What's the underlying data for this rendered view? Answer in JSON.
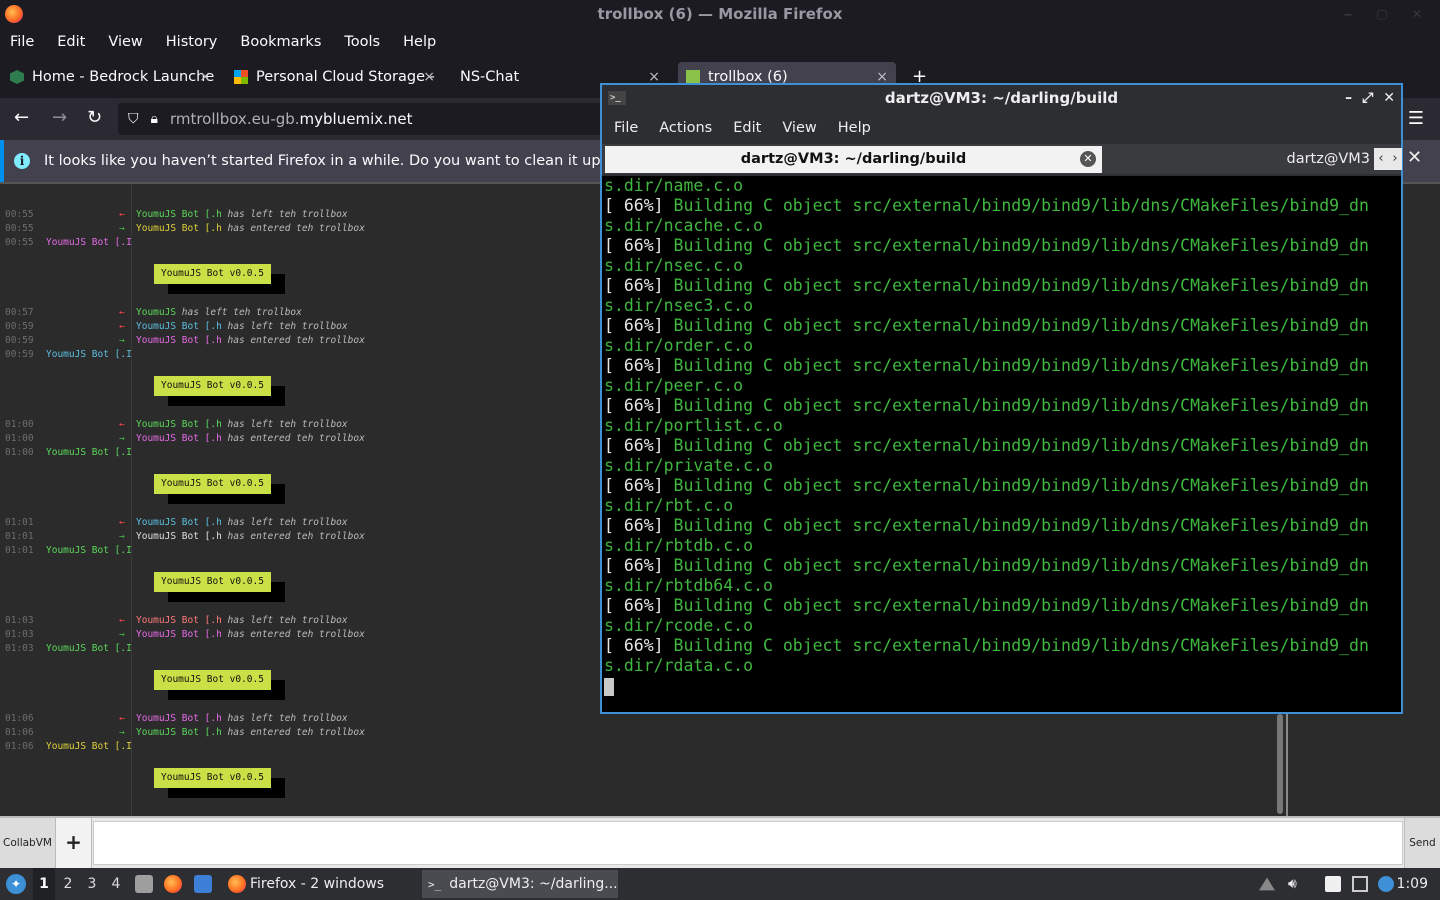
{
  "firefox": {
    "window_title": "trollbox (6) — Mozilla Firefox",
    "menu": [
      "File",
      "Edit",
      "View",
      "History",
      "Bookmarks",
      "Tools",
      "Help"
    ],
    "tabs": [
      {
        "label": "Home - Bedrock Launche",
        "close": "×"
      },
      {
        "label": "Personal Cloud Storage -",
        "close": "×"
      },
      {
        "label": "NS-Chat",
        "close": "×"
      },
      {
        "label": "trollbox (6)",
        "close": "×"
      }
    ],
    "new_tab": "+",
    "url_prefix": "rmtrollbox.eu-gb.",
    "url_domain": "mybluemix.net",
    "notification": "It looks like you haven’t started Firefox in a while. Do you want to clean it up for a f",
    "colors": {
      "accent": "#0090ed",
      "chrome": "#1c1b22"
    }
  },
  "trollbox": {
    "blocks": [
      {
        "lines": [
          {
            "time": "00:55",
            "dir": "out",
            "user": "YoumuJS Bot",
            "suffix": " [.h",
            "action": " has left teh trollbox",
            "color": "#5bd85b"
          },
          {
            "time": "00:55",
            "dir": "in",
            "user": "YoumuJS Bot",
            "suffix": " [.h",
            "action": " has entered teh trollbox",
            "color": "#e0d23a"
          }
        ],
        "speaker_time": "00:55",
        "speaker": "YoumuJS Bot [.I",
        "speaker_color": "#e86be8",
        "box": "YoumuJS Bot v0.0.5"
      },
      {
        "lines": [
          {
            "time": "00:57",
            "dir": "out",
            "user": "YoumuJS",
            "suffix": "",
            "action": " has left teh trollbox",
            "color": "#5bd85b"
          },
          {
            "time": "00:59",
            "dir": "out",
            "user": "YoumuJS Bot",
            "suffix": " [.h",
            "action": " has left teh trollbox",
            "color": "#5bc0e0"
          },
          {
            "time": "00:59",
            "dir": "in",
            "user": "YoumuJS Bot",
            "suffix": " [.h",
            "action": " has entered teh trollbox",
            "color": "#e86be8"
          }
        ],
        "speaker_time": "00:59",
        "speaker": "YoumuJS Bot [.I",
        "speaker_color": "#5bc0e0",
        "box": "YoumuJS Bot v0.0.5"
      },
      {
        "lines": [
          {
            "time": "01:00",
            "dir": "out",
            "user": "YoumuJS Bot",
            "suffix": " [.h",
            "action": " has left teh trollbox",
            "color": "#5bd85b"
          },
          {
            "time": "01:00",
            "dir": "in",
            "user": "YoumuJS Bot",
            "suffix": " [.h",
            "action": " has entered teh trollbox",
            "color": "#e86be8"
          }
        ],
        "speaker_time": "01:00",
        "speaker": "YoumuJS Bot [.I",
        "speaker_color": "#5bd85b",
        "box": "YoumuJS Bot v0.0.5"
      },
      {
        "lines": [
          {
            "time": "01:01",
            "dir": "out",
            "user": "YoumuJS Bot",
            "suffix": " [.h",
            "action": " has left teh trollbox",
            "color": "#5bc0e0"
          },
          {
            "time": "01:01",
            "dir": "in",
            "user": "YoumuJS Bot",
            "suffix": " [.h",
            "action": " has entered teh trollbox",
            "color": "#e0e0e0"
          }
        ],
        "speaker_time": "01:01",
        "speaker": "YoumuJS Bot [.I",
        "speaker_color": "#5bd85b",
        "box": "YoumuJS Bot v0.0.5"
      },
      {
        "lines": [
          {
            "time": "01:03",
            "dir": "out",
            "user": "YoumuJS Bot",
            "suffix": " [.h",
            "action": " has left teh trollbox",
            "color": "#ff7a7a"
          },
          {
            "time": "01:03",
            "dir": "in",
            "user": "YoumuJS Bot",
            "suffix": " [.h",
            "action": " has entered teh trollbox",
            "color": "#e86be8"
          }
        ],
        "speaker_time": "01:03",
        "speaker": "YoumuJS Bot [.I",
        "speaker_color": "#5bd85b",
        "box": "YoumuJS Bot v0.0.5"
      },
      {
        "lines": [
          {
            "time": "01:06",
            "dir": "out",
            "user": "YoumuJS Bot",
            "suffix": " [.h",
            "action": " has left teh trollbox",
            "color": "#e86be8"
          },
          {
            "time": "01:06",
            "dir": "in",
            "user": "YoumuJS Bot",
            "suffix": " [.h",
            "action": " has entered teh trollbox",
            "color": "#5bd85b"
          }
        ],
        "speaker_time": "01:06",
        "speaker": "YoumuJS Bot [.I",
        "speaker_color": "#e0d23a",
        "box": "YoumuJS Bot v0.0.5"
      }
    ],
    "arrows": {
      "in": "→",
      "out": "←"
    }
  },
  "chatbar": {
    "collab_label": "CollabVM",
    "add": "+",
    "send": "Send"
  },
  "terminal": {
    "title": "dartz@VM3: ~/darling/build",
    "menu": [
      "File",
      "Actions",
      "Edit",
      "View",
      "Help"
    ],
    "tab_active": "dartz@VM3: ~/darling/build",
    "tab_second": "dartz@VM3",
    "output": [
      {
        "pct": "",
        "text": "s.dir/name.c.o"
      },
      {
        "pct": "[ 66%]",
        "text": " Building C object src/external/bind9/bind9/lib/dns/CMakeFiles/bind9_dn"
      },
      {
        "pct": "",
        "text": "s.dir/ncache.c.o"
      },
      {
        "pct": "[ 66%]",
        "text": " Building C object src/external/bind9/bind9/lib/dns/CMakeFiles/bind9_dn"
      },
      {
        "pct": "",
        "text": "s.dir/nsec.c.o"
      },
      {
        "pct": "[ 66%]",
        "text": " Building C object src/external/bind9/bind9/lib/dns/CMakeFiles/bind9_dn"
      },
      {
        "pct": "",
        "text": "s.dir/nsec3.c.o"
      },
      {
        "pct": "[ 66%]",
        "text": " Building C object src/external/bind9/bind9/lib/dns/CMakeFiles/bind9_dn"
      },
      {
        "pct": "",
        "text": "s.dir/order.c.o"
      },
      {
        "pct": "[ 66%]",
        "text": " Building C object src/external/bind9/bind9/lib/dns/CMakeFiles/bind9_dn"
      },
      {
        "pct": "",
        "text": "s.dir/peer.c.o"
      },
      {
        "pct": "[ 66%]",
        "text": " Building C object src/external/bind9/bind9/lib/dns/CMakeFiles/bind9_dn"
      },
      {
        "pct": "",
        "text": "s.dir/portlist.c.o"
      },
      {
        "pct": "[ 66%]",
        "text": " Building C object src/external/bind9/bind9/lib/dns/CMakeFiles/bind9_dn"
      },
      {
        "pct": "",
        "text": "s.dir/private.c.o"
      },
      {
        "pct": "[ 66%]",
        "text": " Building C object src/external/bind9/bind9/lib/dns/CMakeFiles/bind9_dn"
      },
      {
        "pct": "",
        "text": "s.dir/rbt.c.o"
      },
      {
        "pct": "[ 66%]",
        "text": " Building C object src/external/bind9/bind9/lib/dns/CMakeFiles/bind9_dn"
      },
      {
        "pct": "",
        "text": "s.dir/rbtdb.c.o"
      },
      {
        "pct": "[ 66%]",
        "text": " Building C object src/external/bind9/bind9/lib/dns/CMakeFiles/bind9_dn"
      },
      {
        "pct": "",
        "text": "s.dir/rbtdb64.c.o"
      },
      {
        "pct": "[ 66%]",
        "text": " Building C object src/external/bind9/bind9/lib/dns/CMakeFiles/bind9_dn"
      },
      {
        "pct": "",
        "text": "s.dir/rcode.c.o"
      },
      {
        "pct": "[ 66%]",
        "text": " Building C object src/external/bind9/bind9/lib/dns/CMakeFiles/bind9_dn"
      },
      {
        "pct": "",
        "text": "s.dir/rdata.c.o"
      }
    ]
  },
  "taskbar": {
    "workspaces": [
      "1",
      "2",
      "3",
      "4"
    ],
    "tasks": [
      {
        "label": "Firefox - 2 windows"
      },
      {
        "label": "dartz@VM3: ~/darling..."
      }
    ],
    "clock": "1:09"
  }
}
